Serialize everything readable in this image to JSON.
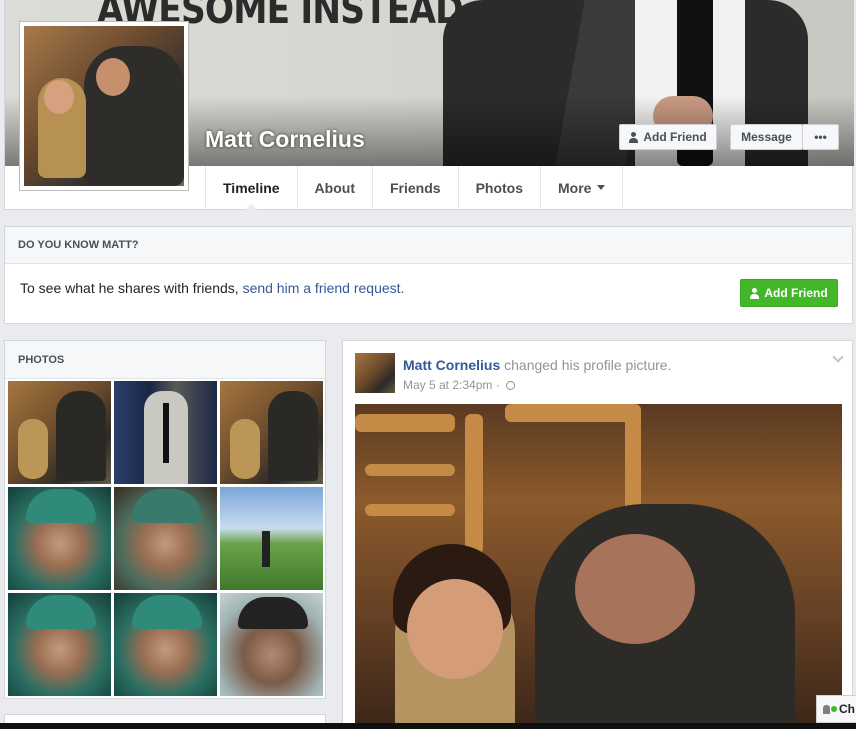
{
  "cover": {
    "banner_text": "AWESOME INSTEAD."
  },
  "profile": {
    "name": "Matt Cornelius"
  },
  "cover_buttons": {
    "add_friend": "Add Friend",
    "message": "Message",
    "more": "•••"
  },
  "tabs": [
    {
      "label": "Timeline"
    },
    {
      "label": "About"
    },
    {
      "label": "Friends"
    },
    {
      "label": "Photos"
    },
    {
      "label": "More"
    }
  ],
  "know": {
    "title": "DO YOU KNOW MATT?",
    "text": "To see what he shares with friends,",
    "link": "send him a friend request.",
    "button": "Add Friend"
  },
  "photos": {
    "title": "PHOTOS"
  },
  "post": {
    "author": "Matt Cornelius",
    "action": "changed his profile picture.",
    "time": "May 5 at 2:34pm ·"
  },
  "chat": {
    "label": "Ch"
  }
}
